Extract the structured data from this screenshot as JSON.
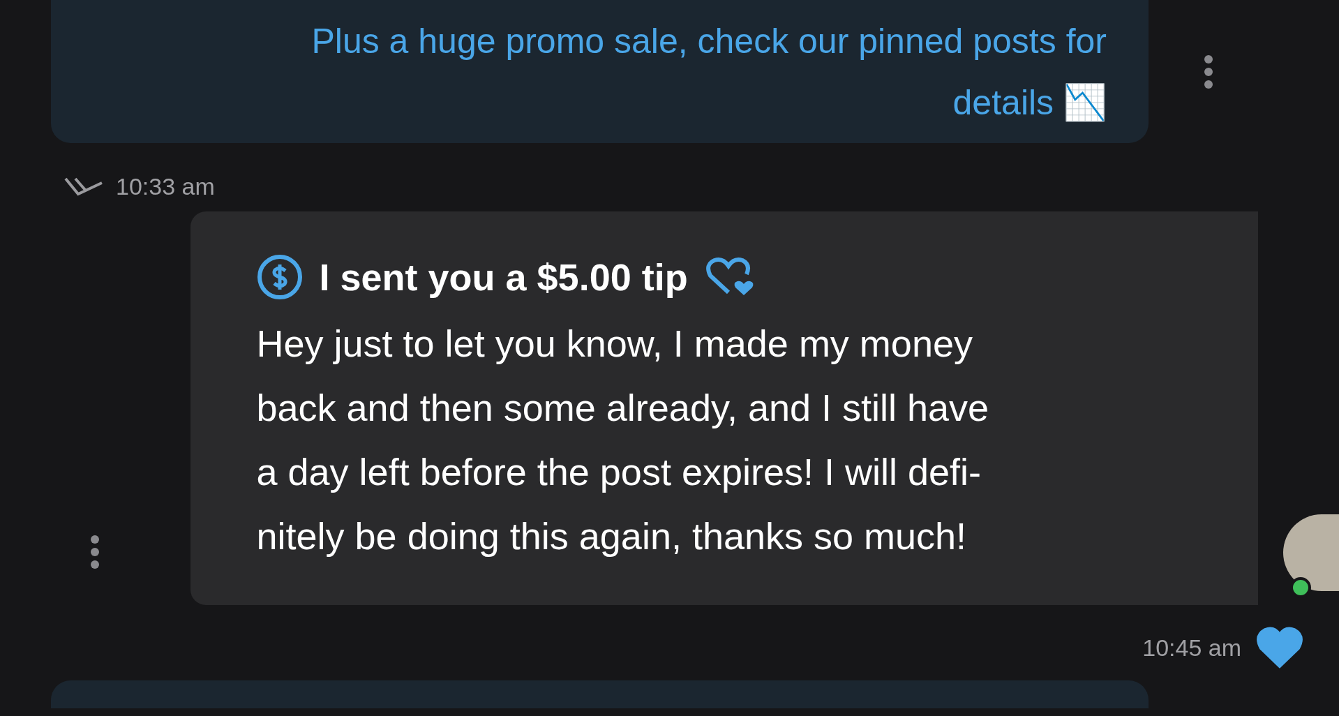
{
  "messages": [
    {
      "kind": "promo",
      "lines": [
        "Plus a huge promo sale, check our pinned posts for",
        "details 📉"
      ],
      "time": "10:33 am",
      "read": true
    },
    {
      "kind": "tip",
      "tip_label": "I sent you a $5.00 tip",
      "lines": [
        "Hey just to let you know, I made my money",
        "back and then some already, and I still have",
        "a day left before the post expires! I will defi-",
        "nitely be doing this again, thanks so much!"
      ],
      "time": "10:45 am",
      "liked": true,
      "online": true
    }
  ]
}
